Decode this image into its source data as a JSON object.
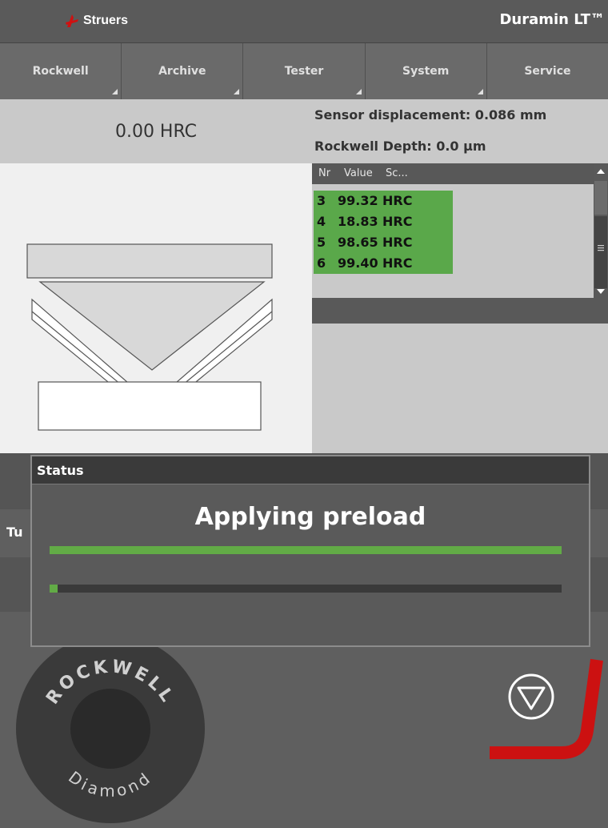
{
  "header": {
    "brand": "Struers",
    "product": "Duramin LT™"
  },
  "nav": {
    "tabs": [
      "Rockwell",
      "Archive",
      "Tester",
      "System",
      "Service"
    ]
  },
  "reading": {
    "value": "0.00 HRC"
  },
  "sensor": {
    "displacement": "Sensor displacement: 0.086 mm",
    "depth": "Rockwell Depth: 0.0 µm"
  },
  "table": {
    "headers": [
      "Nr",
      "Value",
      "Sc..."
    ],
    "rows": [
      {
        "nr": "3",
        "value": "99.32",
        "scale": "HRC"
      },
      {
        "nr": "4",
        "value": "18.83",
        "scale": "HRC"
      },
      {
        "nr": "5",
        "value": "98.65",
        "scale": "HRC"
      },
      {
        "nr": "6",
        "value": "99.40",
        "scale": "HRC"
      }
    ]
  },
  "background": {
    "partial_label": "Tu"
  },
  "status": {
    "title": "Status",
    "message": "Applying preload",
    "preload_progress": 1.0,
    "total_progress": 0.015
  },
  "logo": {
    "top_text": "ROCKWELL",
    "bottom_text": "Diamond"
  },
  "colors": {
    "progress": "#62ab46",
    "table_row": "#5aa84a",
    "brand_red": "#d01010",
    "stop_red": "#cc1111"
  },
  "icons": {
    "stop": "stop-triangle-icon",
    "brand": "struers-logo-icon",
    "menu": "hamburger-icon"
  }
}
